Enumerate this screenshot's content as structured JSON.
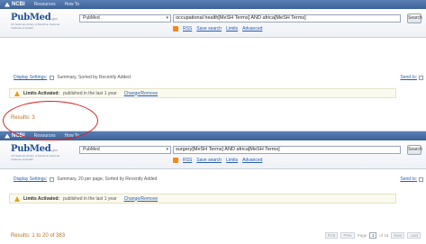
{
  "top_bar": {
    "ncbi": "NCBI",
    "resources": "Resources",
    "howto": "How To"
  },
  "logo": {
    "name": "PubMed",
    "suffix": ".gov",
    "tagline": "US National Library of Medicine National Institutes of Health"
  },
  "panels": [
    {
      "database": "PubMed",
      "query": "occupational health[MeSH Terms] AND africa[MeSH Terms]",
      "search_button": "Search",
      "rss": "RSS",
      "save_search": "Save search",
      "limits": "Limits",
      "advanced": "Advanced",
      "display_settings": "Display Settings:",
      "display_text": "Summary, Sorted by Recently Added",
      "send_to": "Send to:",
      "limits_label": "Limits Activated:",
      "limits_msg": "published in the last 1 year",
      "change_remove": "Change/Remove",
      "results": "Results: 3"
    },
    {
      "database": "PubMed",
      "query": "surgery[MeSH Terms] AND africa[MeSH Terms]",
      "search_button": "Search",
      "rss": "RSS",
      "save_search": "Save search",
      "limits": "Limits",
      "advanced": "Advanced",
      "display_settings": "Display Settings:",
      "display_text": "Summary, 20 per page, Sorted by Recently Added",
      "send_to": "Send to:",
      "limits_label": "Limits Activated:",
      "limits_msg": "published in the last 1 year",
      "change_remove": "Change/Remove",
      "results": "Results: 1 to 20 of 383",
      "pager": {
        "first": "First",
        "prev": "Prev",
        "page_label": "Page",
        "page": "1",
        "of": "of 16",
        "next": "Next",
        "last": "Last"
      }
    }
  ],
  "colors": {
    "header_blue": "#3d6198",
    "link": "#2a5db0",
    "results": "#b8731f",
    "highlight_circle": "#d9201e"
  }
}
